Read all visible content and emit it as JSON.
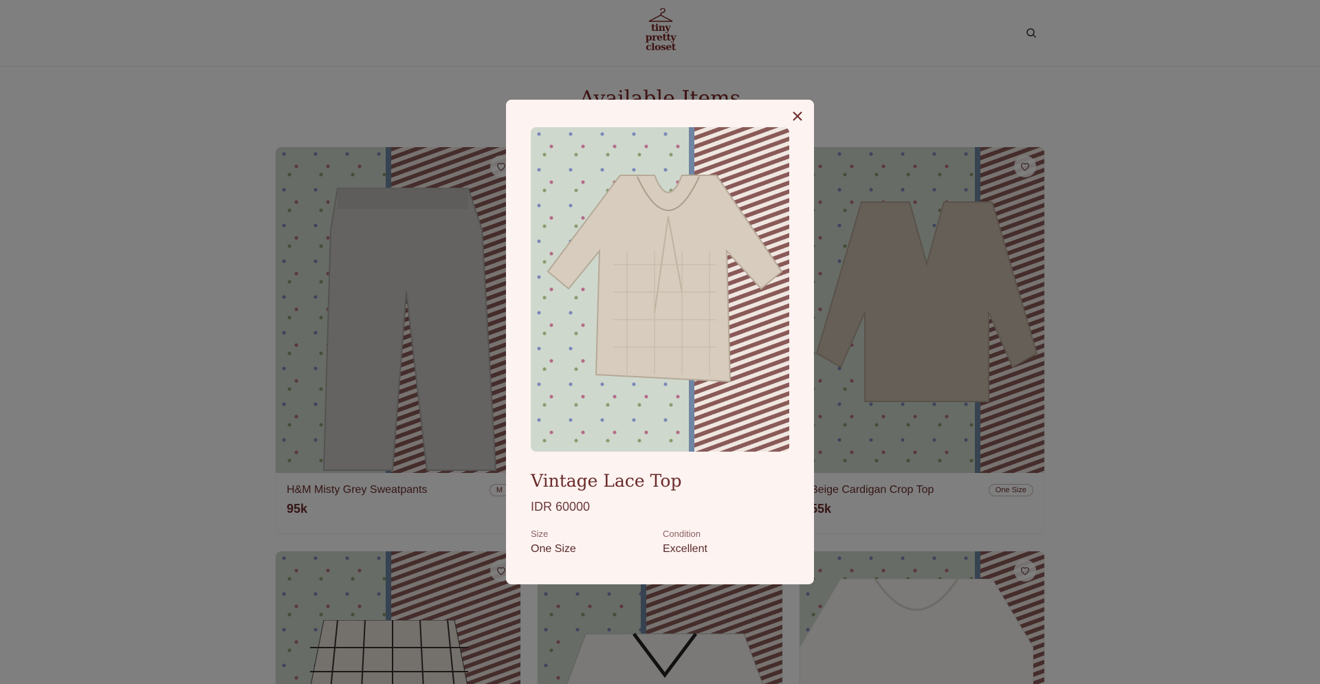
{
  "header": {
    "logo_lines": [
      "tiny",
      "pretty",
      "closet"
    ],
    "search_icon": "search-icon"
  },
  "page": {
    "heading": "Available Items"
  },
  "cards": [
    {
      "title": "H&M Misty Grey Sweatpants",
      "price": "95k",
      "size": "M"
    },
    {
      "title": "Beige Cardigan Crop Top",
      "price": "55k",
      "size": "One Size"
    }
  ],
  "modal": {
    "title": "Vintage Lace Top",
    "price": "IDR 60000",
    "size_label": "Size",
    "size_value": "One Size",
    "condition_label": "Condition",
    "condition_value": "Excellent"
  },
  "colors": {
    "accent": "#7a2424",
    "modal_bg": "#fdf3f1"
  }
}
